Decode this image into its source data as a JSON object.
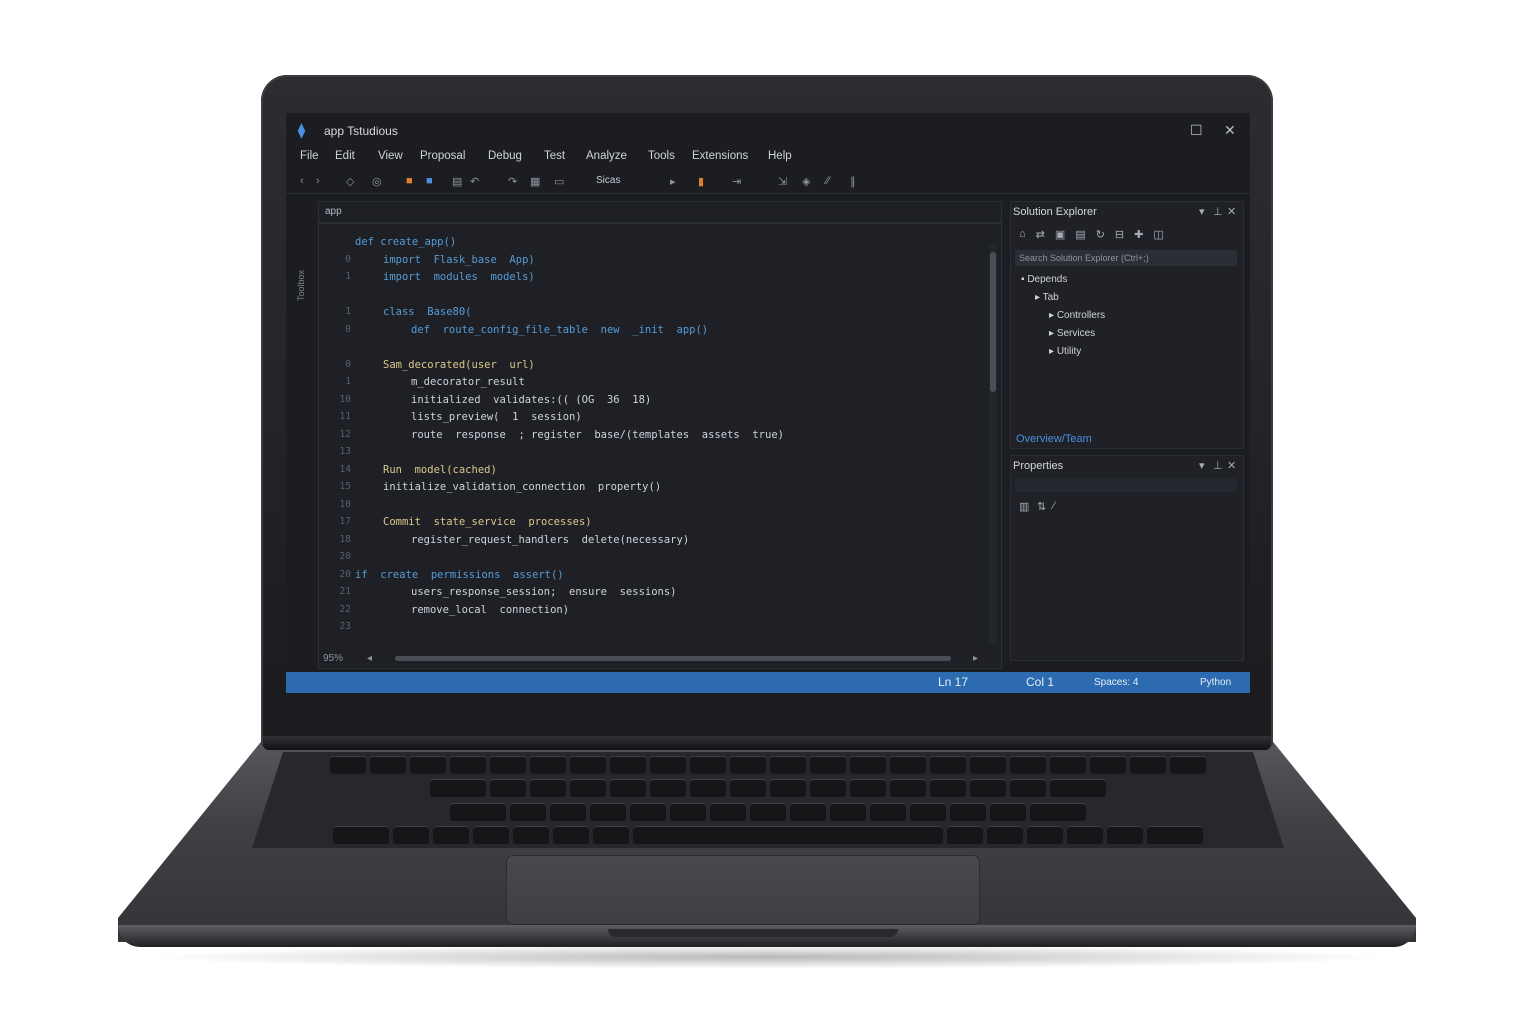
{
  "window": {
    "title": "app  Tstudious",
    "controls": {
      "maximize": "☐",
      "close": "✕"
    }
  },
  "menu": [
    "File",
    "Edit",
    "View",
    "Proposal",
    "Debug",
    "Test",
    "Analyze",
    "Tools",
    "Extensions",
    "Help"
  ],
  "toolbar": {
    "config_combo": "Sicas"
  },
  "left_strip": "Toolbox",
  "editor": {
    "tab": "app",
    "zoom": "95%",
    "lines": [
      {
        "n": "",
        "indent": 0,
        "text": "def create_app()"
      },
      {
        "n": "0",
        "indent": 1,
        "text": "import  Flask_base  App)"
      },
      {
        "n": "1",
        "indent": 1,
        "text": "import  modules  models)"
      },
      {
        "n": "",
        "indent": 0,
        "text": ""
      },
      {
        "n": "1",
        "indent": 1,
        "text": "class  Base80("
      },
      {
        "n": "0",
        "indent": 2,
        "text": "def  route_config_file_table  new  _init  app()"
      },
      {
        "n": "",
        "indent": 0,
        "text": ""
      },
      {
        "n": "0",
        "indent": 1,
        "text": "Sam_decorated(user  url)"
      },
      {
        "n": "1",
        "indent": 2,
        "text": "m_decorator_result"
      },
      {
        "n": "10",
        "indent": 2,
        "text": "initialized  validates:(( (OG  36  18)"
      },
      {
        "n": "11",
        "indent": 2,
        "text": "lists_preview(  1  session)"
      },
      {
        "n": "12",
        "indent": 2,
        "text": "route  response  ; register  base/(templates  assets  true)"
      },
      {
        "n": "13",
        "indent": 0,
        "text": ""
      },
      {
        "n": "14",
        "indent": 1,
        "text": "Run  model(cached)"
      },
      {
        "n": "15",
        "indent": 1,
        "text": "initialize_validation_connection  property()"
      },
      {
        "n": "10",
        "indent": 0,
        "text": ""
      },
      {
        "n": "17",
        "indent": 1,
        "text": "Commit  state_service  processes)"
      },
      {
        "n": "18",
        "indent": 2,
        "text": "register_request_handlers  delete(necessary)"
      },
      {
        "n": "20",
        "indent": 0,
        "text": ""
      },
      {
        "n": "20",
        "indent": 0,
        "text": "if  create  permissions  assert()"
      },
      {
        "n": "21",
        "indent": 2,
        "text": "users_response_session;  ensure  sessions)"
      },
      {
        "n": "22",
        "indent": 2,
        "text": "remove_local  connection)"
      },
      {
        "n": "23",
        "indent": 0,
        "text": ""
      }
    ]
  },
  "solution_explorer": {
    "title": "Solution Explorer",
    "search_placeholder": "Search Solution Explorer (Ctrl+;)",
    "items": [
      {
        "label": "Depends",
        "depth": 0
      },
      {
        "label": "Tab",
        "depth": 1
      },
      {
        "label": "Controllers",
        "depth": 2
      },
      {
        "label": "Services",
        "depth": 2
      },
      {
        "label": "Utility",
        "depth": 2
      }
    ]
  },
  "team_explorer_link": "Overview/Team",
  "properties": {
    "title": "Properties"
  },
  "status_bar": {
    "line": "Ln 17",
    "col": "Col 1",
    "spaces": "Spaces: 4",
    "encoding": "Python"
  }
}
